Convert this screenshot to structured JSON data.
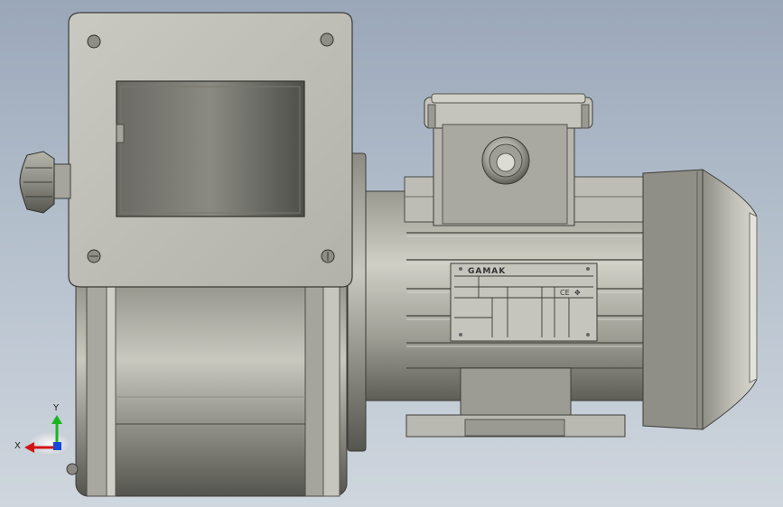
{
  "nameplate": {
    "brand": "GAMAK",
    "ce_mark": "CE"
  },
  "triad": {
    "x_label": "X",
    "y_label": "Y",
    "x_icon": "red-arrow",
    "y_icon": "green-arrow",
    "z_icon": "blue-arrow"
  },
  "colors": {
    "background_top": "#9aa7b9",
    "background_bottom": "#cfd6de",
    "x_axis": "#d11414",
    "y_axis": "#19b51e",
    "z_axis": "#1846d6"
  }
}
